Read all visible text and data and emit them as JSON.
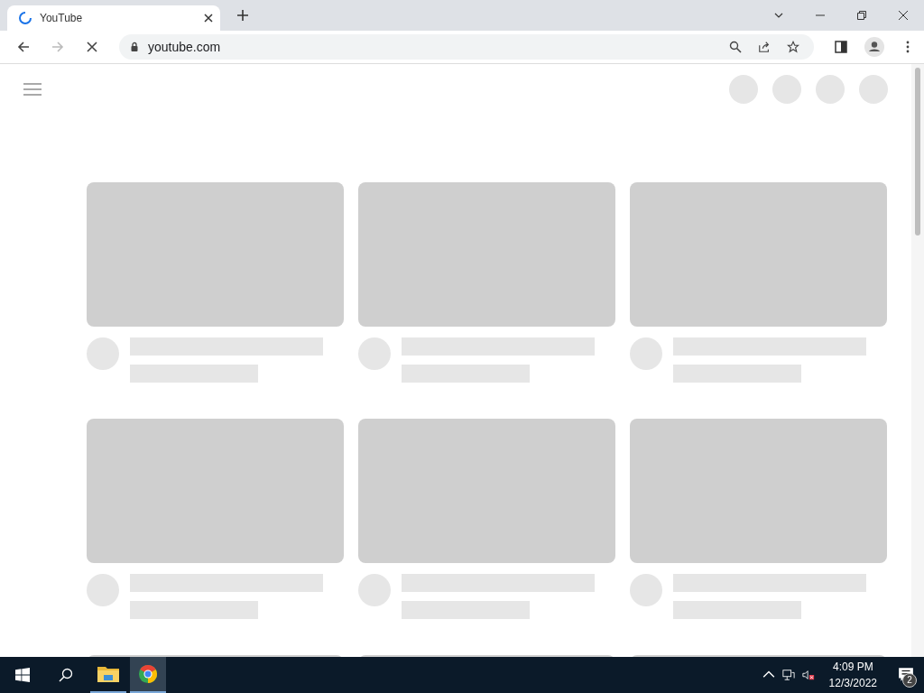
{
  "tabs": [
    {
      "title": "YouTube",
      "loading": true,
      "selected": true
    }
  ],
  "address_bar": {
    "url": "youtube.com"
  },
  "taskbar": {
    "apps": [
      {
        "kind": "files",
        "selected": false
      },
      {
        "kind": "chrome",
        "selected": true
      }
    ],
    "clock": {
      "time": "4:09 PM",
      "date": "12/3/2022"
    },
    "notifications": {
      "count": "2"
    }
  }
}
